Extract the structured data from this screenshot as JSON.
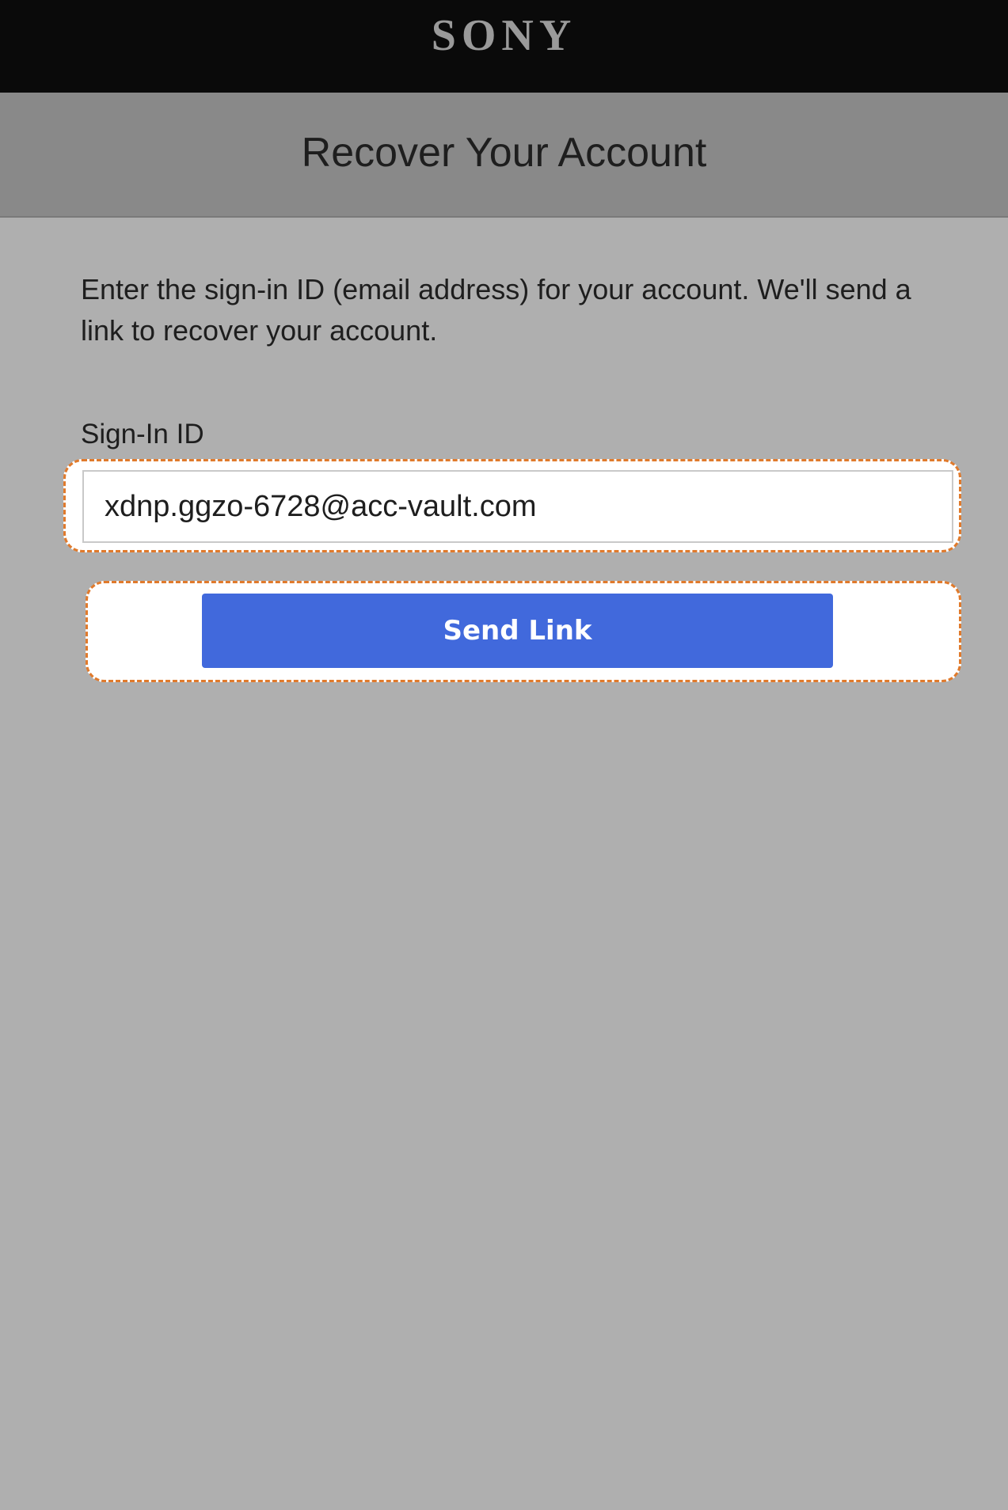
{
  "header": {
    "brand": "SONY",
    "title": "Recover Your Account"
  },
  "main": {
    "instructions": "Enter the sign-in ID (email address) for your account. We'll send a link to recover your account.",
    "signin_label": "Sign-In ID",
    "signin_value": "xdnp.ggzo-6728@acc-vault.com",
    "send_button_label": "Send Link"
  },
  "colors": {
    "topbar": "#0a0a0a",
    "header_band": "#898989",
    "page_background": "#afafaf",
    "button": "#4169dc",
    "highlight_outline": "#e07a2c"
  }
}
